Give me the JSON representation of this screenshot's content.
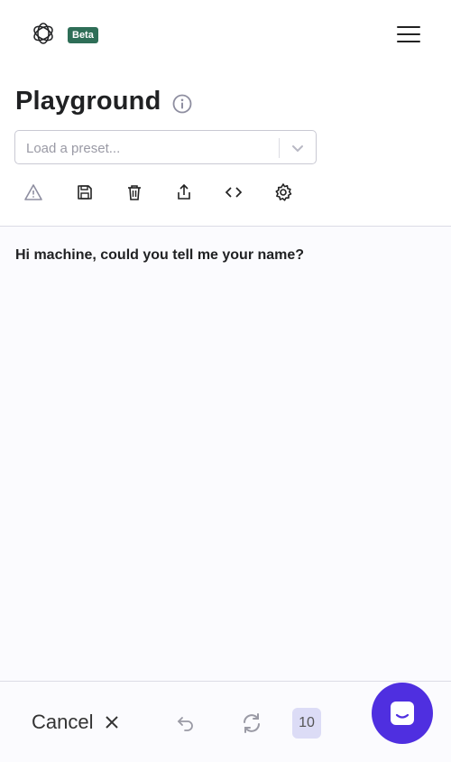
{
  "header": {
    "logo_icon": "openai-logo-icon",
    "badge": "Beta",
    "menu_icon": "hamburger-menu-icon"
  },
  "page": {
    "title": "Playground",
    "info_icon": "info-icon"
  },
  "preset": {
    "placeholder": "Load a preset..."
  },
  "toolbar": {
    "icons": [
      "warning-icon",
      "save-icon",
      "trash-icon",
      "share-icon",
      "code-icon",
      "settings-icon"
    ]
  },
  "editor": {
    "prompt_text": "Hi machine, could you tell me your name?"
  },
  "footer": {
    "cancel_label": "Cancel",
    "count": "10",
    "accent_color": "#4f2fe0"
  }
}
